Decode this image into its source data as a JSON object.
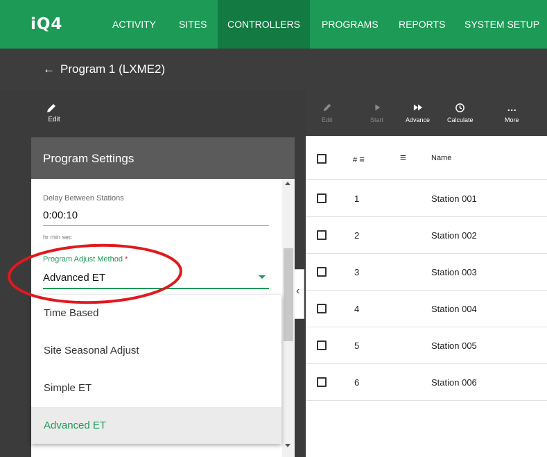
{
  "nav": {
    "logo": "iQ4",
    "items": [
      "ACTIVITY",
      "SITES",
      "CONTROLLERS",
      "PROGRAMS",
      "REPORTS",
      "SYSTEM SETUP"
    ],
    "active": "CONTROLLERS"
  },
  "header": {
    "back_arrow": "←",
    "title": "Program 1 (LXME2)"
  },
  "left_toolbar": {
    "edit_label": "Edit"
  },
  "panel": {
    "title": "Program Settings",
    "delay_label": "Delay Between Stations",
    "delay_value": "0:00:10",
    "delay_hint": "hr min sec",
    "adjust_label": "Program Adjust Method",
    "adjust_required": "*",
    "adjust_value": "Advanced ET",
    "options": [
      "Time Based",
      "Site Seasonal Adjust",
      "Simple ET",
      "Advanced ET"
    ],
    "selected_option": "Advanced ET"
  },
  "right_toolbar": {
    "items": [
      {
        "label": "Edit",
        "icon": "pencil-icon",
        "enabled": false
      },
      {
        "label": "Start",
        "icon": "play-icon",
        "enabled": false
      },
      {
        "label": "Advance",
        "icon": "fast-forward-icon",
        "enabled": true
      },
      {
        "label": "Calculate",
        "icon": "clock-icon",
        "enabled": true
      },
      {
        "label": "More",
        "icon": "more-icon",
        "enabled": true
      }
    ]
  },
  "table": {
    "col_number": "#",
    "col_name": "Name",
    "rows": [
      {
        "num": "1",
        "name": "Station 001"
      },
      {
        "num": "2",
        "name": "Station 002"
      },
      {
        "num": "3",
        "name": "Station 003"
      },
      {
        "num": "4",
        "name": "Station 004"
      },
      {
        "num": "5",
        "name": "Station 005"
      },
      {
        "num": "6",
        "name": "Station 006"
      }
    ]
  },
  "colors": {
    "brand_green": "#1c9a56",
    "active_nav": "#137a42",
    "annotation_red": "#e0191e"
  }
}
